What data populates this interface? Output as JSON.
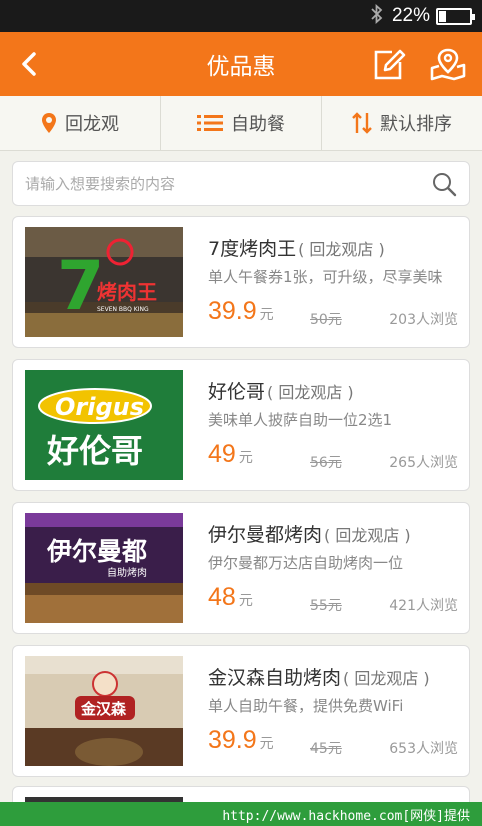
{
  "status_bar": {
    "battery_text": "22%",
    "battery_level": 0.22,
    "bluetooth_icon": "bluetooth-icon"
  },
  "header": {
    "title": "优品惠",
    "back_icon": "back-arrow-icon",
    "edit_icon": "edit-icon",
    "location_icon": "map-pin-icon"
  },
  "filters": [
    {
      "label": "回龙观",
      "icon": "location-pin-icon"
    },
    {
      "label": "自助餐",
      "icon": "list-icon"
    },
    {
      "label": "默认排序",
      "icon": "sort-icon"
    }
  ],
  "search": {
    "placeholder": "请输入想要搜索的内容",
    "value": "",
    "icon": "search-icon"
  },
  "deals": [
    {
      "name": "7度烤肉王",
      "branch": "( 回龙观店 )",
      "desc": "单人午餐券1张，可升级，尽享美味",
      "price": "39.9",
      "unit": "元",
      "original_price": "50元",
      "views": "203人浏览",
      "logo_text": "7",
      "logo_sub": "烤肉王",
      "logo_en": "SEVEN BBQ KING"
    },
    {
      "name": "好伦哥",
      "branch": "( 回龙观店 )",
      "desc": "美味单人披萨自助一位2选1",
      "price": "49",
      "unit": "元",
      "original_price": "56元",
      "views": "265人浏览",
      "logo_text": "Origus",
      "logo_sub": "好伦哥"
    },
    {
      "name": "伊尔曼都烤肉",
      "branch": "( 回龙观店 )",
      "desc": "伊尔曼都万达店自助烤肉一位",
      "price": "48",
      "unit": "元",
      "original_price": "55元",
      "views": "421人浏览",
      "logo_text": "伊尔曼都",
      "logo_sub": "自助烤肉"
    },
    {
      "name": "金汉森自助烤肉",
      "branch": "( 回龙观店 )",
      "desc": "单人自助午餐，提供免费WiFi",
      "price": "39.9",
      "unit": "元",
      "original_price": "45元",
      "views": "653人浏览",
      "logo_text": "金汉森"
    }
  ],
  "watermark": "http://www.hackhome.com[网侠]提供",
  "colors": {
    "accent": "#f3761a",
    "header_bg": "#f3761a",
    "watermark_bg": "#2e9d3c"
  }
}
